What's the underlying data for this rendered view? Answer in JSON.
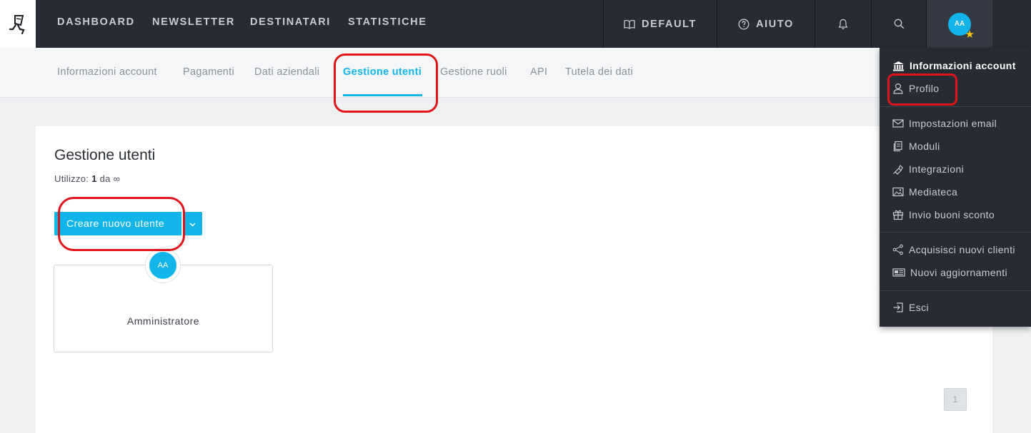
{
  "topbar": {
    "nav": [
      "DASHBOARD",
      "NEWSLETTER",
      "DESTINATARI",
      "STATISTICHE"
    ],
    "default_label": "DEFAULT",
    "help_label": "AIUTO",
    "avatar_initials": "AA",
    "icons": [
      "logo-icon",
      "book-icon",
      "help-circle-icon",
      "bell-icon",
      "search-icon",
      "star-badge-icon"
    ]
  },
  "subnav": {
    "items": [
      "Informazioni account",
      "Pagamenti",
      "Dati aziendali",
      "Gestione utenti",
      "Gestione ruoli",
      "API",
      "Tutela dei dati"
    ],
    "active": "Gestione utenti"
  },
  "main": {
    "title": "Gestione utenti",
    "usage_label": "Utilizzo:",
    "usage_count": "1",
    "usage_of": "da",
    "usage_limit": "∞",
    "create_button": "Creare nuovo utente",
    "user_card": {
      "initials": "AA",
      "role": "Amministratore"
    },
    "pagination": {
      "current_page": "1"
    }
  },
  "dropdown": {
    "header": "Informazioni account",
    "items": [
      {
        "label": "Profilo",
        "icon": "user-icon"
      },
      {
        "label": "Impostazioni email",
        "icon": "envelope-icon"
      },
      {
        "label": "Moduli",
        "icon": "forms-icon"
      },
      {
        "label": "Integrazioni",
        "icon": "plug-icon"
      },
      {
        "label": "Mediateca",
        "icon": "image-icon"
      },
      {
        "label": "Invio buoni sconto",
        "icon": "gift-icon"
      },
      {
        "label": "Acquisisci nuovi clienti",
        "icon": "share-icon"
      },
      {
        "label": "Nuovi aggiornamenti",
        "icon": "newspaper-icon"
      },
      {
        "label": "Esci",
        "icon": "logout-icon"
      }
    ]
  },
  "colors": {
    "accent": "#12b5ea",
    "topbar": "#272b33",
    "annotation": "#e0141b",
    "star": "#f4c20d"
  }
}
